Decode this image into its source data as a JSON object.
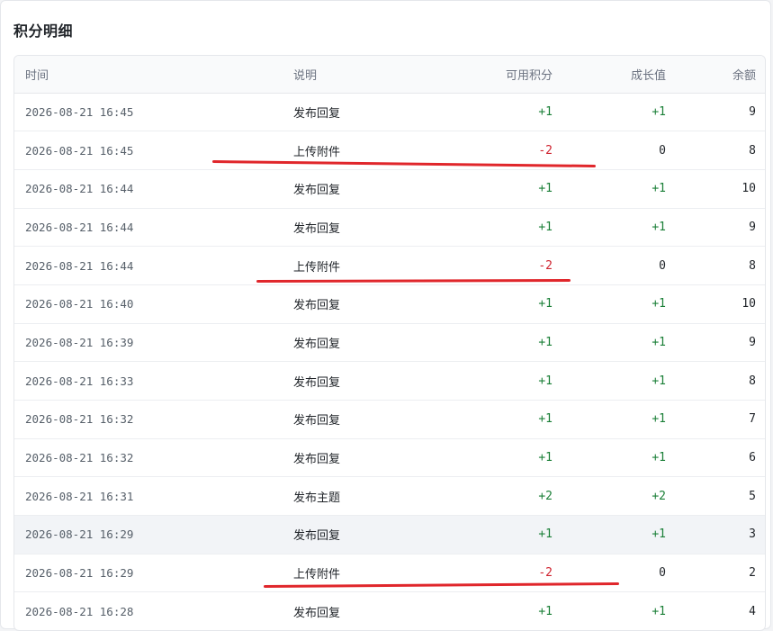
{
  "page_title": "积分明细",
  "columns": [
    "时间",
    "说明",
    "可用积分",
    "成长值",
    "余额"
  ],
  "rows": [
    {
      "time": "2026-08-21 16:45",
      "desc": "发布回复",
      "points": "+1",
      "growth": "+1",
      "balance": "9"
    },
    {
      "time": "2026-08-21 16:45",
      "desc": "上传附件",
      "points": "-2",
      "growth": "0",
      "balance": "8"
    },
    {
      "time": "2026-08-21 16:44",
      "desc": "发布回复",
      "points": "+1",
      "growth": "+1",
      "balance": "10"
    },
    {
      "time": "2026-08-21 16:44",
      "desc": "发布回复",
      "points": "+1",
      "growth": "+1",
      "balance": "9"
    },
    {
      "time": "2026-08-21 16:44",
      "desc": "上传附件",
      "points": "-2",
      "growth": "0",
      "balance": "8"
    },
    {
      "time": "2026-08-21 16:40",
      "desc": "发布回复",
      "points": "+1",
      "growth": "+1",
      "balance": "10"
    },
    {
      "time": "2026-08-21 16:39",
      "desc": "发布回复",
      "points": "+1",
      "growth": "+1",
      "balance": "9"
    },
    {
      "time": "2026-08-21 16:33",
      "desc": "发布回复",
      "points": "+1",
      "growth": "+1",
      "balance": "8"
    },
    {
      "time": "2026-08-21 16:32",
      "desc": "发布回复",
      "points": "+1",
      "growth": "+1",
      "balance": "7"
    },
    {
      "time": "2026-08-21 16:32",
      "desc": "发布回复",
      "points": "+1",
      "growth": "+1",
      "balance": "6"
    },
    {
      "time": "2026-08-21 16:31",
      "desc": "发布主题",
      "points": "+2",
      "growth": "+2",
      "balance": "5"
    },
    {
      "time": "2026-08-21 16:29",
      "desc": "发布回复",
      "points": "+1",
      "growth": "+1",
      "balance": "3"
    },
    {
      "time": "2026-08-21 16:29",
      "desc": "上传附件",
      "points": "-2",
      "growth": "0",
      "balance": "2"
    },
    {
      "time": "2026-08-21 16:28",
      "desc": "发布回复",
      "points": "+1",
      "growth": "+1",
      "balance": "4"
    }
  ],
  "highlighted_row": 11,
  "annotations": [
    1,
    4,
    12
  ],
  "colors": {
    "positive": "#1a7f37",
    "negative": "#cf222e",
    "annotation": "#e0262b"
  }
}
